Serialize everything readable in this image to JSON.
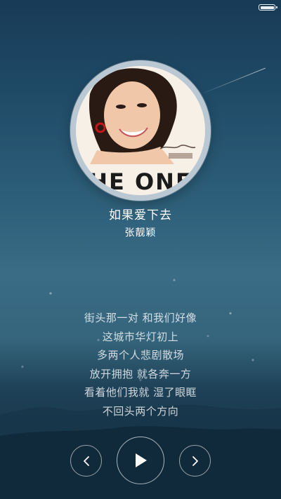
{
  "status_bar": {
    "battery_icon": "battery-full-icon"
  },
  "now_playing": {
    "album_art": "album-cover",
    "title": "如果爱下去",
    "artist": "张靓颖"
  },
  "lyrics": [
    "街头那一对 和我们好像",
    "这城市华灯初上",
    "多两个人悲剧散场",
    "放开拥抱 就各奔一方",
    "看着他们我就 湿了眼眶",
    "不回头两个方向"
  ],
  "controls": {
    "previous_icon": "chevron-left-icon",
    "play_icon": "play-icon",
    "next_icon": "chevron-right-icon"
  },
  "colors": {
    "text": "#ffffff",
    "background_top": "#183b57",
    "background_mid": "#3a6c86",
    "ring": "#b9c8d2"
  }
}
